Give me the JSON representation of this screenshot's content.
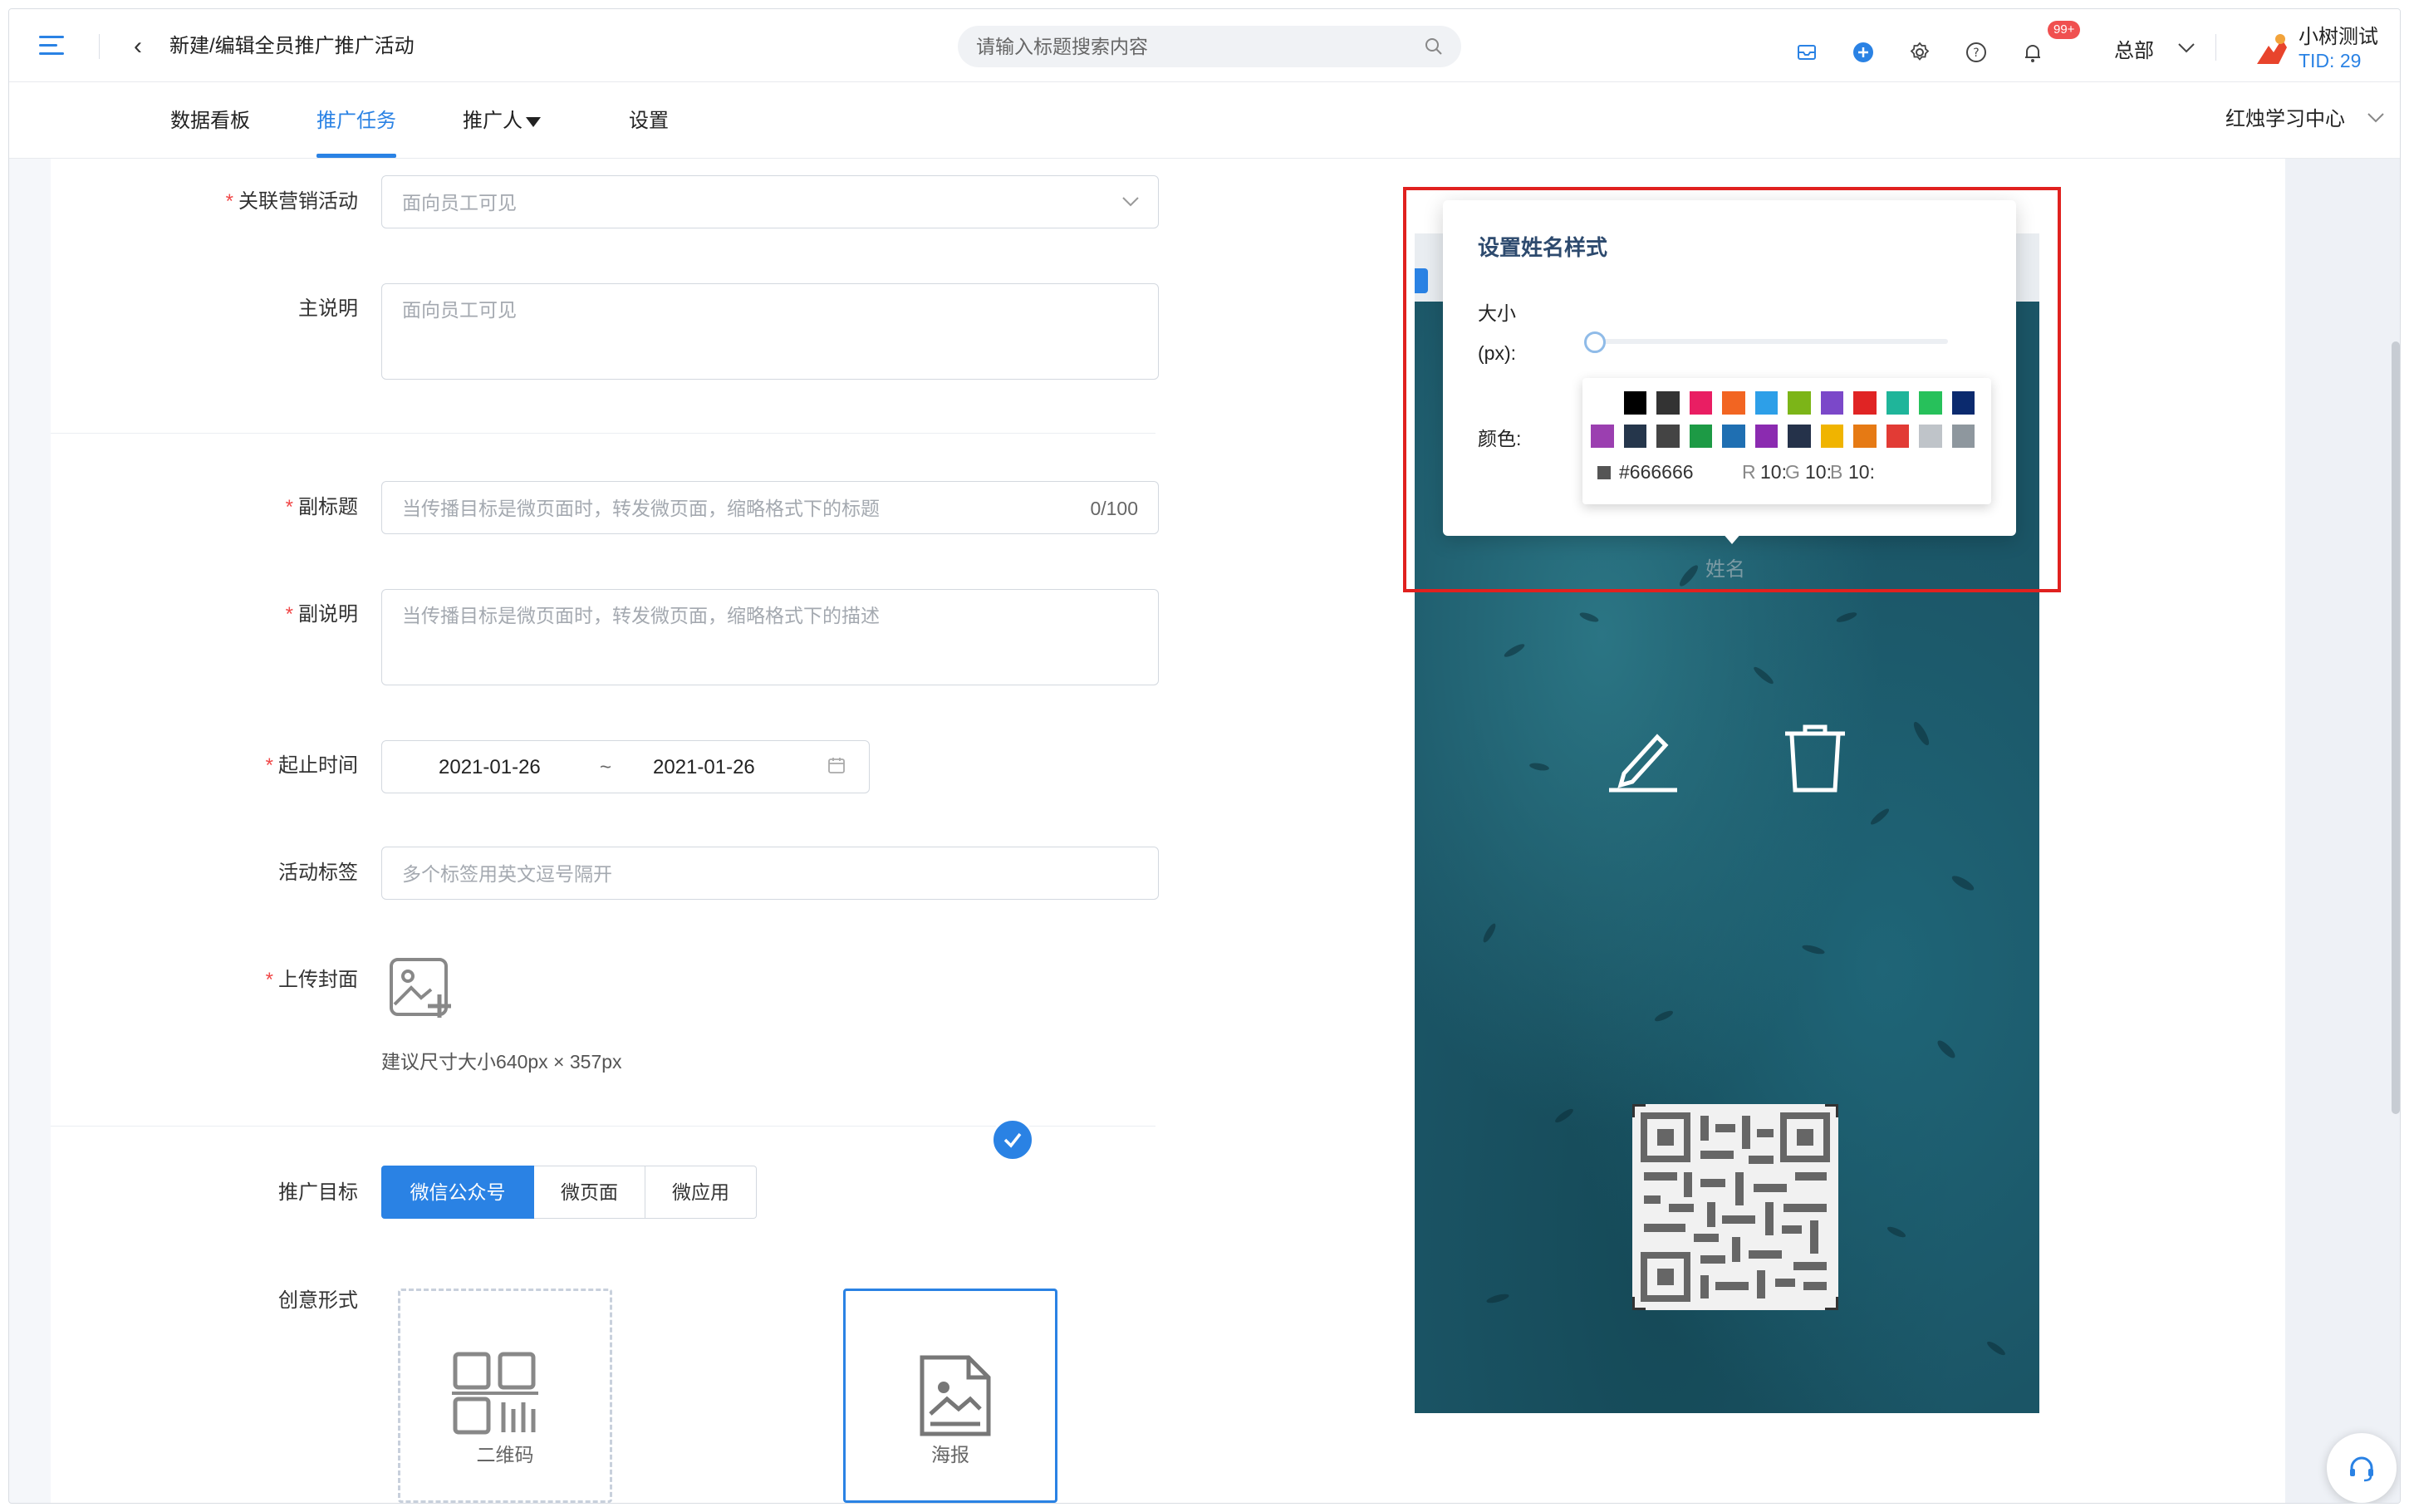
{
  "header": {
    "page_title": "新建/编辑全员推广推广活动",
    "search_placeholder": "请输入标题搜索内容",
    "notification_badge": "99+",
    "org": "总部",
    "user_name": "小树测试",
    "user_tid": "TID: 29"
  },
  "tabs": [
    {
      "label": "数据看板"
    },
    {
      "label": "推广任务"
    },
    {
      "label": "推广人"
    },
    {
      "label": "设置"
    }
  ],
  "active_tab": "推广任务",
  "center_select": "红烛学习中心",
  "form": {
    "activity": {
      "label": "关联营销活动",
      "placeholder": "面向员工可见"
    },
    "main_desc": {
      "label": "主说明",
      "placeholder": "面向员工可见"
    },
    "subtitle": {
      "label": "副标题",
      "placeholder": "当传播目标是微页面时，转发微页面，缩略格式下的标题",
      "counter": "0/100"
    },
    "sub_desc": {
      "label": "副说明",
      "placeholder": "当传播目标是微页面时，转发微页面，缩略格式下的描述"
    },
    "date_range": {
      "label": "起止时间",
      "start": "2021-01-26",
      "separator": "~",
      "end": "2021-01-26"
    },
    "tags": {
      "label": "活动标签",
      "placeholder": "多个标签用英文逗号隔开"
    },
    "cover": {
      "label": "上传封面",
      "hint": "建议尺寸大小640px × 357px"
    },
    "target": {
      "label": "推广目标",
      "options": [
        "微信公众号",
        "微页面",
        "微应用"
      ],
      "selected": "微信公众号"
    },
    "creative": {
      "label": "创意形式",
      "options": [
        "二维码",
        "海报"
      ],
      "selected": "海报"
    }
  },
  "popover": {
    "title": "设置姓名样式",
    "size_label": "大小(px):",
    "size_value_fraction": 0,
    "color_label": "颜色:",
    "swatches_row1": [
      "#ffffff",
      "#000000",
      "#333333",
      "#e91e63",
      "#f26522",
      "#2d9fe8",
      "#7cb518",
      "#7b48c9",
      "#e02424",
      "#1fb59a",
      "#27c15b",
      "#0b2a6e"
    ],
    "swatches_row2": [
      "#9b3fb0",
      "#25364b",
      "#444444",
      "#1d9a45",
      "#1f6fb2",
      "#8b2bb0",
      "#25324a",
      "#f0b400",
      "#e67a14",
      "#e23b35",
      "#bfc4c9",
      "#8e979e"
    ],
    "hex": "#666666",
    "r_label": "R",
    "r_value": "10:",
    "g_label": "G",
    "g_value": "10:",
    "b_label": "B",
    "b_value": "10:"
  },
  "preview": {
    "name_placeholder": "姓名"
  },
  "colors": {
    "accent": "#2a82e4",
    "required": "#f04848",
    "highlight": "#e0211f"
  }
}
